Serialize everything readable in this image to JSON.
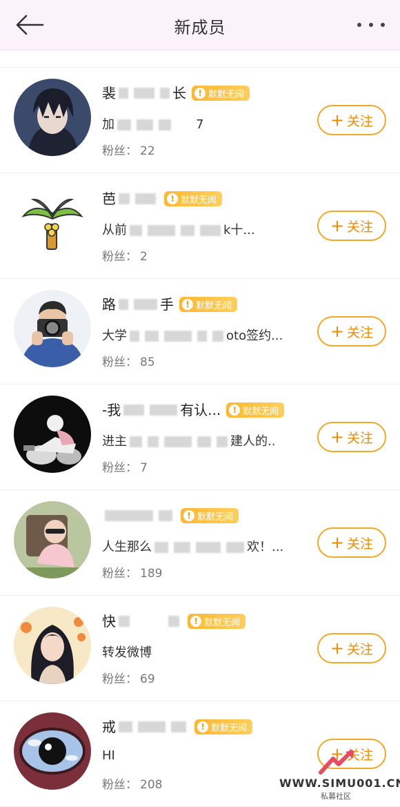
{
  "header": {
    "title": "新成员"
  },
  "members": [
    {
      "name_start": "裴",
      "name_end": "长",
      "badge": "默默无闻",
      "desc_start": "加",
      "desc_end": "7",
      "fans_label": "粉丝：",
      "fans": "22",
      "follow_label": "关注",
      "avatar": "anime-boy-avatar"
    },
    {
      "name_start": "芭",
      "name_end": "",
      "badge": "默默无闻",
      "desc_start": "从前",
      "desc_end": "k十...",
      "fans_label": "粉丝：",
      "fans": "2",
      "follow_label": "关注",
      "avatar": "palm-tree-avatar"
    },
    {
      "name_start": "路",
      "name_end": "手",
      "badge": "默默无闻",
      "desc_start": "大学",
      "desc_end": "oto签约...",
      "fans_label": "粉丝：",
      "fans": "85",
      "follow_label": "关注",
      "avatar": "photographer-avatar"
    },
    {
      "name_start": "-我",
      "name_end": "有认...",
      "badge": "默默无闻",
      "desc_start": "进主",
      "desc_end": "建人的..",
      "fans_label": "粉丝：",
      "fans": "7",
      "follow_label": "关注",
      "avatar": "motorcycle-avatar"
    },
    {
      "name_start": "",
      "name_end": "",
      "badge": "默默无闻",
      "desc_start": "人生那么",
      "desc_end": "欢！...",
      "fans_label": "粉丝：",
      "fans": "189",
      "follow_label": "关注",
      "avatar": "baby-avatar"
    },
    {
      "name_start": "快",
      "name_end": "",
      "badge": "默默无闻",
      "desc_start": "转发微博",
      "desc_end": "",
      "fans_label": "粉丝：",
      "fans": "69",
      "follow_label": "关注",
      "avatar": "girl-illustration-avatar"
    },
    {
      "name_start": "戒",
      "name_end": "",
      "badge": "默默无闻",
      "desc_start": "HI",
      "desc_end": "",
      "fans_label": "粉丝：",
      "fans": "208",
      "follow_label": "关注",
      "avatar": "eye-art-avatar"
    }
  ],
  "watermark": {
    "text": "WWW.SIMU001.CN",
    "sub": "私募社区"
  }
}
